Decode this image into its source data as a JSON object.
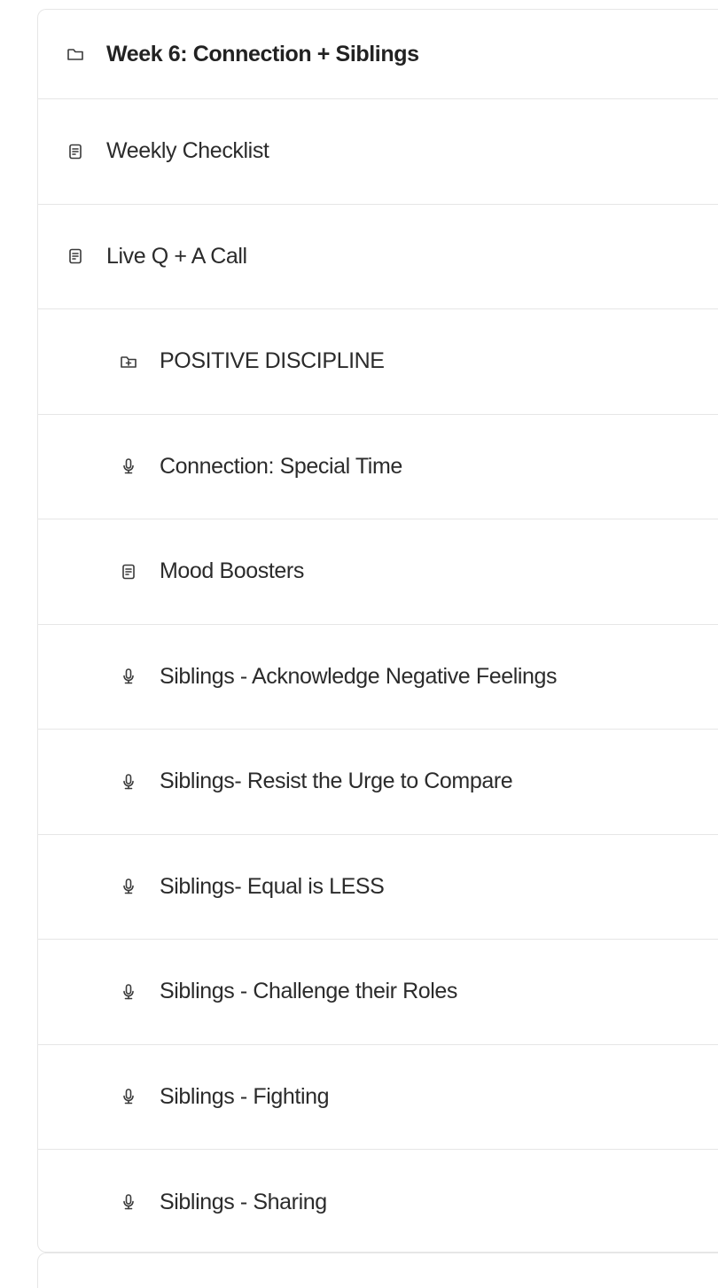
{
  "module": {
    "title": "Week 6: Connection + Siblings",
    "icon": "folder-icon"
  },
  "items": [
    {
      "label": "Weekly Checklist",
      "icon": "document-icon"
    },
    {
      "label": "Live Q + A Call",
      "icon": "document-icon"
    },
    {
      "label": "POSITIVE DISCIPLINE",
      "icon": "folder-plus-icon"
    },
    {
      "label": "Connection: Special Time",
      "icon": "microphone-icon"
    },
    {
      "label": "Mood Boosters",
      "icon": "document-icon"
    },
    {
      "label": "Siblings - Acknowledge Negative Feelings",
      "icon": "microphone-icon"
    },
    {
      "label": "Siblings- Resist the Urge to Compare",
      "icon": "microphone-icon"
    },
    {
      "label": "Siblings- Equal is LESS",
      "icon": "microphone-icon"
    },
    {
      "label": "Siblings - Challenge their Roles",
      "icon": "microphone-icon"
    },
    {
      "label": "Siblings - Fighting",
      "icon": "microphone-icon"
    },
    {
      "label": "Siblings - Sharing",
      "icon": "microphone-icon"
    }
  ]
}
